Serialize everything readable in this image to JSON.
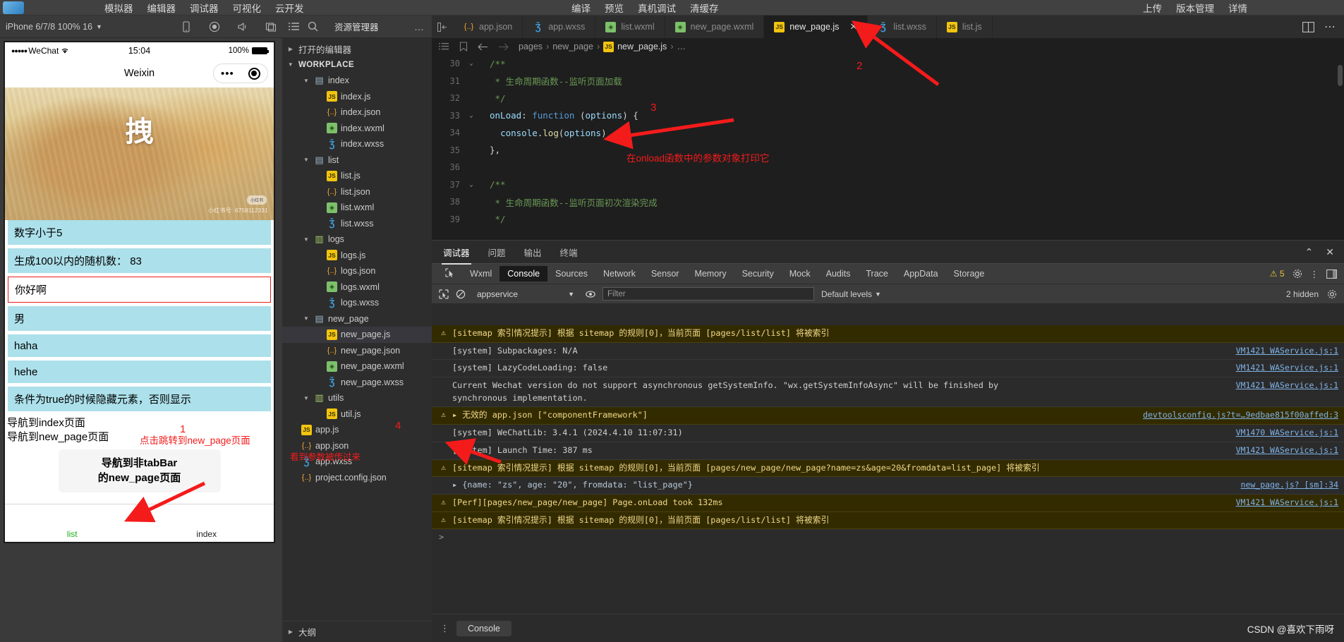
{
  "topbar": {
    "left_menus": [
      "模拟器",
      "编辑器",
      "调试器",
      "可视化",
      "云开发"
    ],
    "mid_menus": [
      "编译",
      "预览",
      "真机调试",
      "清缓存"
    ],
    "right_menus": [
      "上传",
      "版本管理",
      "详情"
    ]
  },
  "simulator": {
    "device": "iPhone 6/7/8 100% 16",
    "caret": "▼",
    "icons": [
      "phone-rotate-icon",
      "record-icon",
      "mute-icon",
      "window-icon"
    ],
    "status": {
      "carrier": "WeChat",
      "dots": "●●●●●",
      "wifi": "wifi-icon",
      "time": "15:04",
      "battery": "100%"
    },
    "nav": {
      "title": "Weixin",
      "capsule_more": "•••",
      "capsule_target": "target-icon"
    },
    "image": {
      "word": "拽",
      "badge": "小红书",
      "credit": "小红书号: 6758112331"
    },
    "rows": [
      "数字小于5",
      "生成100以内的随机数： 83",
      "你好啊",
      "男",
      "haha",
      "hehe",
      "条件为true的时候隐藏元素，否则显示"
    ],
    "input_row_index": 2,
    "navlinks": [
      "导航到index页面",
      "导航到new_page页面"
    ],
    "tip_box": [
      "导航到非tabBar",
      "的new_page页面"
    ],
    "tabbar": [
      {
        "label": "list",
        "active": true
      },
      {
        "label": "index",
        "active": false
      }
    ]
  },
  "explorer": {
    "title": "资源管理器",
    "more": "…",
    "open_editors": "打开的编辑器",
    "workplace": "WORKPLACE",
    "outline": "大纲",
    "tree": [
      {
        "label": "index",
        "type": "folder",
        "depth": 1,
        "arrow": "▼"
      },
      {
        "label": "index.js",
        "type": "js",
        "depth": 2
      },
      {
        "label": "index.json",
        "type": "json",
        "depth": 2
      },
      {
        "label": "index.wxml",
        "type": "wxml",
        "depth": 2
      },
      {
        "label": "index.wxss",
        "type": "wxss",
        "depth": 2
      },
      {
        "label": "list",
        "type": "folder",
        "depth": 1,
        "arrow": "▼"
      },
      {
        "label": "list.js",
        "type": "js",
        "depth": 2
      },
      {
        "label": "list.json",
        "type": "json",
        "depth": 2
      },
      {
        "label": "list.wxml",
        "type": "wxml",
        "depth": 2
      },
      {
        "label": "list.wxss",
        "type": "wxss",
        "depth": 2
      },
      {
        "label": "logs",
        "type": "folder-g",
        "depth": 1,
        "arrow": "▼"
      },
      {
        "label": "logs.js",
        "type": "js",
        "depth": 2
      },
      {
        "label": "logs.json",
        "type": "json",
        "depth": 2
      },
      {
        "label": "logs.wxml",
        "type": "wxml",
        "depth": 2
      },
      {
        "label": "logs.wxss",
        "type": "wxss",
        "depth": 2
      },
      {
        "label": "new_page",
        "type": "folder",
        "depth": 1,
        "arrow": "▼"
      },
      {
        "label": "new_page.js",
        "type": "js",
        "depth": 2,
        "selected": true
      },
      {
        "label": "new_page.json",
        "type": "json",
        "depth": 2
      },
      {
        "label": "new_page.wxml",
        "type": "wxml",
        "depth": 2
      },
      {
        "label": "new_page.wxss",
        "type": "wxss",
        "depth": 2
      },
      {
        "label": "utils",
        "type": "folder-g",
        "depth": 1,
        "arrow": "▼"
      },
      {
        "label": "util.js",
        "type": "js",
        "depth": 2
      },
      {
        "label": "app.js",
        "type": "js",
        "depth": 0
      },
      {
        "label": "app.json",
        "type": "json",
        "depth": 0
      },
      {
        "label": "app.wxss",
        "type": "wxss",
        "depth": 0
      },
      {
        "label": "project.config.json",
        "type": "json",
        "depth": 0
      }
    ]
  },
  "editor": {
    "tabs": [
      {
        "label": "app.json",
        "type": "json",
        "active": false
      },
      {
        "label": "app.wxss",
        "type": "wxss",
        "active": false
      },
      {
        "label": "list.wxml",
        "type": "wxml",
        "active": false
      },
      {
        "label": "new_page.wxml",
        "type": "wxml",
        "active": false
      },
      {
        "label": "new_page.js",
        "type": "js",
        "active": true,
        "close": "✕"
      },
      {
        "label": "list.wxss",
        "type": "wxss",
        "active": false
      },
      {
        "label": "list.js",
        "type": "js",
        "active": false
      }
    ],
    "breadcrumb": [
      "pages",
      "new_page",
      "new_page.js",
      "…"
    ],
    "breadcrumb_sep": "›",
    "lines": [
      {
        "n": "30",
        "fold": "⌄",
        "html": "<span class='cm'>/**</span>"
      },
      {
        "n": "31",
        "fold": "",
        "html": "<span class='cm'> * 生命周期函数--监听页面加载</span>"
      },
      {
        "n": "32",
        "fold": "",
        "html": "<span class='cm'> */</span>"
      },
      {
        "n": "33",
        "fold": "⌄",
        "html": "<span class='pm'>onLoad</span><span class='br'>: </span><span class='kw'>function</span> <span class='br'>(</span><span class='pm'>options</span><span class='br'>) {</span>"
      },
      {
        "n": "34",
        "fold": "",
        "html": "  <span class='pm'>console</span><span class='br'>.</span><span class='fn'>log</span><span class='br'>(</span><span class='pm'>options</span><span class='br'>)</span>"
      },
      {
        "n": "35",
        "fold": "",
        "html": "<span class='br'>},</span>"
      },
      {
        "n": "36",
        "fold": "",
        "html": ""
      },
      {
        "n": "37",
        "fold": "⌄",
        "html": "<span class='cm'>/**</span>"
      },
      {
        "n": "38",
        "fold": "",
        "html": "<span class='cm'> * 生命周期函数--监听页面初次渲染完成</span>"
      },
      {
        "n": "39",
        "fold": "",
        "html": "<span class='cm'> */</span>"
      }
    ]
  },
  "debugger": {
    "panel_tabs": [
      "调试器",
      "问题",
      "输出",
      "终端"
    ],
    "active_panel_tab": "调试器",
    "devtools_tabs": [
      "Wxml",
      "Console",
      "Sources",
      "Network",
      "Sensor",
      "Memory",
      "Security",
      "Mock",
      "Audits",
      "Trace",
      "AppData",
      "Storage"
    ],
    "active_devtools_tab": "Console",
    "warn_count": "5",
    "context": "appservice",
    "filter_placeholder": "Filter",
    "levels": "Default levels",
    "hidden": "2 hidden",
    "footer_tab": "Console",
    "prompt": ">",
    "logs": [
      {
        "icon": "⚠",
        "level": "warn",
        "msg": "[sitemap 索引情况提示] 根据 sitemap 的规则[0]，当前页面 [pages/list/list] 将被索引",
        "src": ""
      },
      {
        "icon": "",
        "level": "info",
        "msg": "[system] Subpackages: N/A",
        "src": "VM1421 WAService.js:1"
      },
      {
        "icon": "",
        "level": "info",
        "msg": "[system] LazyCodeLoading: false",
        "src": "VM1421 WAService.js:1"
      },
      {
        "icon": "",
        "level": "info",
        "msg": "Current Wechat version do not support asynchronous getSystemInfo. \"wx.getSystemInfoAsync\" will be finished by\nsynchronous implementation.",
        "src": "VM1421 WAService.js:1"
      },
      {
        "icon": "⚠",
        "level": "warn",
        "msg": "▸ 无效的 app.json [\"componentFramework\"]",
        "src": "devtoolsconfig.js?t=…9edbae815f00affed:3"
      },
      {
        "icon": "",
        "level": "info",
        "msg": "[system] WeChatLib: 3.4.1 (2024.4.10 11:07:31)",
        "src": "VM1470 WAService.js:1"
      },
      {
        "icon": "",
        "level": "info",
        "msg": "[system] Launch Time: 387 ms",
        "src": "VM1421 WAService.js:1"
      },
      {
        "icon": "⚠",
        "level": "warn",
        "msg": "[sitemap 索引情况提示] 根据 sitemap 的规则[0]，当前页面 [pages/new_page/new_page?name=zs&age=20&fromdata=list_page] 将被索引",
        "src": ""
      },
      {
        "icon": "",
        "level": "object",
        "msg": "▸ {name: \"zs\", age: \"20\", fromdata: \"list_page\"}",
        "src": "new_page.js? [sm]:34"
      },
      {
        "icon": "⚠",
        "level": "warn",
        "msg": "[Perf][pages/new_page/new_page] Page.onLoad took 132ms",
        "src": "VM1421 WAService.js:1"
      },
      {
        "icon": "⚠",
        "level": "warn",
        "msg": "[sitemap 索引情况提示] 根据 sitemap 的规则[0]，当前页面 [pages/list/list] 将被索引",
        "src": ""
      }
    ]
  },
  "annotations": [
    {
      "id": "1",
      "number": "1",
      "text": "点击跳转到new_page页面"
    },
    {
      "id": "2",
      "number": "2",
      "text": ""
    },
    {
      "id": "3",
      "number": "3",
      "text": "在onload函数中的参数对象打印它"
    },
    {
      "id": "4",
      "number": "4",
      "text": "看到参数被传过来"
    }
  ],
  "watermark": "CSDN @喜欢下雨呀"
}
